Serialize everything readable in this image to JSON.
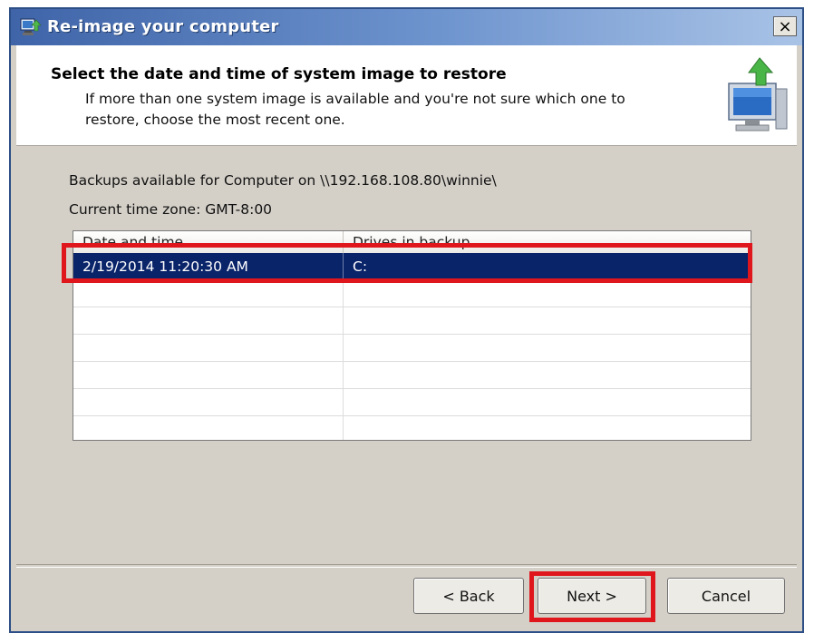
{
  "window": {
    "title": "Re-image your computer",
    "close_symbol": "×"
  },
  "header": {
    "title": "Select the date and time of system image to restore",
    "description": "If more than one system image is available and you're not sure which one to restore, choose the most recent one."
  },
  "content": {
    "backups_text": "Backups available for Computer on \\\\192.168.108.80\\winnie\\",
    "timezone_text": "Current time zone: GMT-8:00",
    "columns": [
      "Date and time",
      "Drives in backup"
    ],
    "rows": [
      {
        "date": "2/19/2014 11:20:30 AM",
        "drives": "C:",
        "selected": true
      }
    ]
  },
  "buttons": {
    "back": "< Back",
    "next": "Next >",
    "cancel": "Cancel"
  },
  "colors": {
    "selection": "#0a246a",
    "highlight_box": "#e0161d",
    "title_bar": "#3f64a8"
  }
}
